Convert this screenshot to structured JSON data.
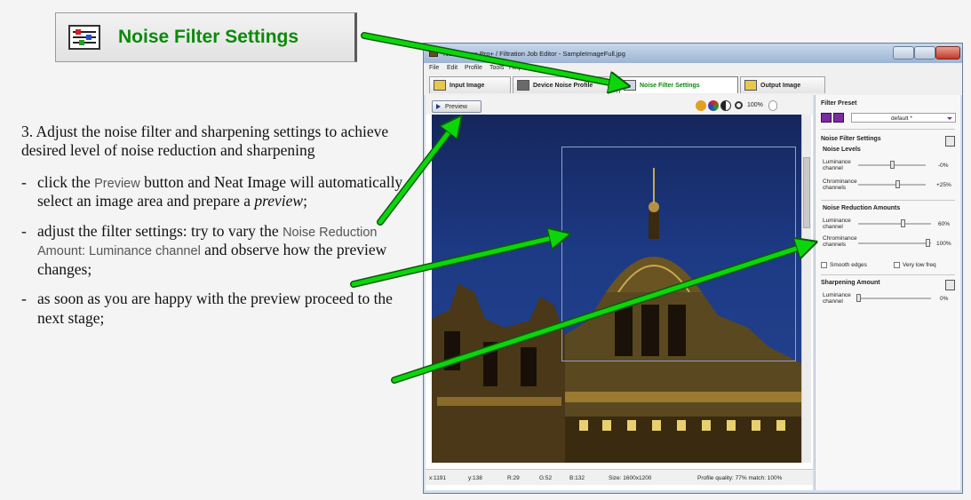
{
  "callout": {
    "label": "Noise Filter Settings",
    "icon": "settings-sliders-icon"
  },
  "instructions": {
    "intro": "3. Adjust the noise filter and sharpening settings to achieve desired level of noise reduction and sharpening",
    "bullet1": {
      "a": "click the ",
      "ref": "Preview",
      "b": " button and Neat Image will automatically select an image area and prepare a ",
      "em": "preview",
      "c": ";"
    },
    "bullet2": {
      "a": "adjust the filter settings: try to vary the ",
      "ref": "Noise Reduction Amount: Luminance channel",
      "b": " and observe how the preview changes;"
    },
    "bullet3": "as soon as you are happy with the preview proceed to the next stage;"
  },
  "window": {
    "title": "Neat Image Pro+ / Filtration Job Editor - SampleImageFull.jpg",
    "menu": [
      "File",
      "Edit",
      "Profile",
      "Tools",
      "Help"
    ],
    "tabs": [
      "Input Image",
      "Device Noise Profile",
      "Noise Filter Settings",
      "Output Image"
    ],
    "active_tab": "Noise Filter Settings",
    "toolbar": {
      "preview": "Preview",
      "zoom": "100%"
    },
    "status": {
      "x": "x:1191",
      "y": "y:138",
      "r": "R:29",
      "g": "G:52",
      "b": "B:132",
      "size": "Size: 1600x1200",
      "quality": "Profile quality: 77%  match: 100%"
    },
    "panel": {
      "preset_header": "Filter Preset",
      "preset_value": "default *",
      "nfs_header": "Noise Filter Settings",
      "levels_header": "Noise Levels",
      "lum_label": "Luminance channel",
      "lum_level": "-0%",
      "chrom_label": "Chrominance channels",
      "chrom_level": "+25%",
      "amounts_header": "Noise Reduction Amounts",
      "lum_amount": "60%",
      "chrom_amount": "100%",
      "smooth_edges": "Smooth edges",
      "very_low_freq": "Very low freq",
      "sharp_header": "Sharpening Amount",
      "sharp_value": "0%"
    }
  },
  "colors": {
    "arrow": "#0bd60b",
    "arrow_outline": "#0a5a0a",
    "active_tab_text": "#0a8a0a"
  }
}
